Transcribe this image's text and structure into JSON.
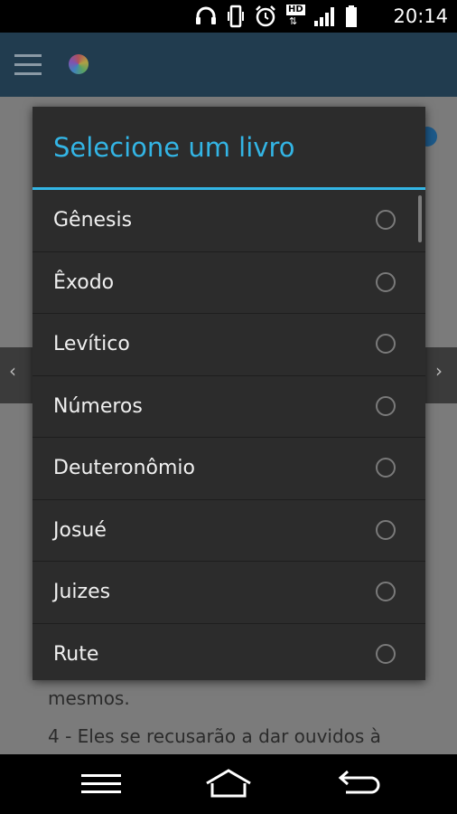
{
  "status_bar": {
    "time": "20:14",
    "icons": [
      "headset-icon",
      "vibrate-icon",
      "alarm-icon",
      "hd-network-icon",
      "signal-icon",
      "battery-icon"
    ],
    "network_label": "HD"
  },
  "app_bar": {
    "menu_icon": "hamburger-icon",
    "logo_icon": "app-logo-icon"
  },
  "background": {
    "text_line_1": "mesmos.",
    "text_line_2": "4 - Eles se recusarão a dar ouvidos à"
  },
  "dialog": {
    "title": "Selecione um livro",
    "accent_color": "#33b5e5",
    "items": [
      {
        "label": "Gênesis",
        "selected": false
      },
      {
        "label": "Êxodo",
        "selected": false
      },
      {
        "label": "Levítico",
        "selected": false
      },
      {
        "label": "Números",
        "selected": false
      },
      {
        "label": "Deuteronômio",
        "selected": false
      },
      {
        "label": "Josué",
        "selected": false
      },
      {
        "label": "Juizes",
        "selected": false
      },
      {
        "label": "Rute",
        "selected": false
      }
    ]
  },
  "nav_bar": {
    "icons": [
      "menu-icon",
      "home-icon",
      "back-icon"
    ]
  }
}
